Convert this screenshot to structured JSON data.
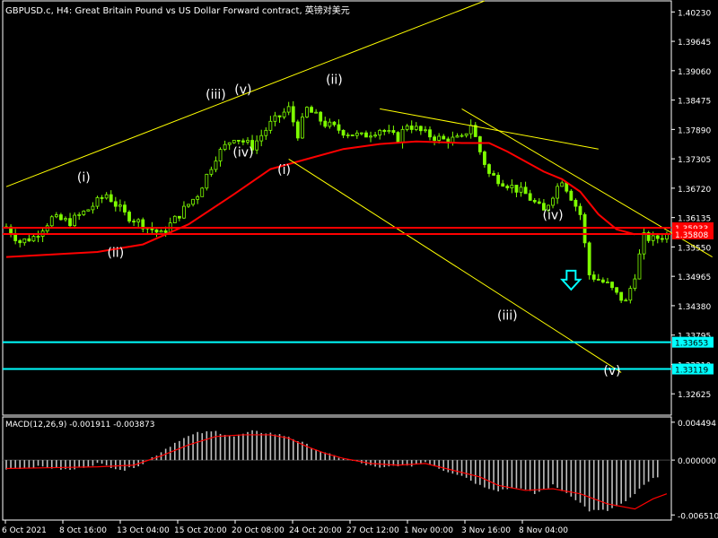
{
  "header": {
    "title": "GBPUSD.c, H4:  Great Britain Pound vs US Dollar Forward contract, 英镑对美元",
    "macd_label": "MACD(12,26,9) -0.001911 -0.003873"
  },
  "colors": {
    "background": "#000000",
    "frame": "#ffffff",
    "candle": "#7fff00",
    "ma": "#ff0000",
    "trendline": "#ffff00",
    "support": "#00ffff",
    "resistance": "#ff0000",
    "macd_hist": "#c0c0c0",
    "macd_signal": "#ff0000",
    "arrow": "#00ffff"
  },
  "chart_data": [
    {
      "type": "candlestick",
      "symbol": "GBPUSD.c",
      "timeframe": "H4",
      "y_axis_ticks": [
        "1.40230",
        "1.39645",
        "1.39060",
        "1.38475",
        "1.37890",
        "1.37305",
        "1.36720",
        "1.36135",
        "1.35550",
        "1.34965",
        "1.34380",
        "1.33795",
        "1.33210",
        "1.32625"
      ],
      "x_axis_ticks": [
        "6 Oct 2021",
        "8 Oct 16:00",
        "13 Oct 04:00",
        "15 Oct 20:00",
        "20 Oct 08:00",
        "24 Oct 20:00",
        "27 Oct 12:00",
        "1 Nov 00:00",
        "3 Nov 16:00",
        "8 Nov 04:00"
      ],
      "ylim": [
        1.322,
        1.4045
      ],
      "bars": 146,
      "close_path": [
        [
          0,
          1.3595
        ],
        [
          3,
          1.3565
        ],
        [
          6,
          1.3575
        ],
        [
          10,
          1.3612
        ],
        [
          14,
          1.3605
        ],
        [
          18,
          1.363
        ],
        [
          22,
          1.366
        ],
        [
          26,
          1.362
        ],
        [
          30,
          1.36
        ],
        [
          34,
          1.358
        ],
        [
          38,
          1.362
        ],
        [
          42,
          1.366
        ],
        [
          46,
          1.3735
        ],
        [
          50,
          1.3775
        ],
        [
          54,
          1.3755
        ],
        [
          58,
          1.38
        ],
        [
          62,
          1.383
        ],
        [
          64,
          1.378
        ],
        [
          66,
          1.383
        ],
        [
          70,
          1.38
        ],
        [
          74,
          1.3785
        ],
        [
          78,
          1.3775
        ],
        [
          82,
          1.379
        ],
        [
          86,
          1.377
        ],
        [
          88,
          1.38
        ],
        [
          92,
          1.378
        ],
        [
          96,
          1.3768
        ],
        [
          100,
          1.377
        ],
        [
          102,
          1.38
        ],
        [
          104,
          1.3745
        ],
        [
          106,
          1.37
        ],
        [
          110,
          1.368
        ],
        [
          114,
          1.366
        ],
        [
          118,
          1.3625
        ],
        [
          120,
          1.366
        ],
        [
          122,
          1.369
        ],
        [
          126,
          1.362
        ],
        [
          128,
          1.35
        ],
        [
          132,
          1.348
        ],
        [
          134,
          1.346
        ],
        [
          136,
          1.3445
        ],
        [
          138,
          1.35
        ],
        [
          140,
          1.3575
        ],
        [
          142,
          1.357
        ],
        [
          145,
          1.358
        ]
      ],
      "moving_average": [
        [
          0,
          1.3535
        ],
        [
          20,
          1.3545
        ],
        [
          30,
          1.356
        ],
        [
          40,
          1.36
        ],
        [
          50,
          1.366
        ],
        [
          58,
          1.371
        ],
        [
          66,
          1.373
        ],
        [
          74,
          1.375
        ],
        [
          82,
          1.376
        ],
        [
          90,
          1.3765
        ],
        [
          100,
          1.3762
        ],
        [
          106,
          1.3762
        ],
        [
          110,
          1.3745
        ],
        [
          118,
          1.3705
        ],
        [
          122,
          1.369
        ],
        [
          126,
          1.3665
        ],
        [
          130,
          1.362
        ],
        [
          134,
          1.359
        ],
        [
          138,
          1.358
        ]
      ],
      "horizontal_levels": [
        {
          "label": "1.35933",
          "price": 1.35933,
          "kind": "resistance"
        },
        {
          "label": "1.35808",
          "price": 1.35808,
          "kind": "resistance"
        },
        {
          "label": "1.33653",
          "price": 1.33653,
          "kind": "support"
        },
        {
          "label": "1.33119",
          "price": 1.33119,
          "kind": "support"
        }
      ],
      "trendlines": [
        {
          "from": [
            0,
            1.3675
          ],
          "to": [
            105,
            1.4045
          ]
        },
        {
          "from": [
            82,
            1.383
          ],
          "to": [
            130,
            1.375
          ]
        },
        {
          "from": [
            62,
            1.373
          ],
          "to": [
            135,
            1.3305
          ]
        },
        {
          "from": [
            100,
            1.383
          ],
          "to": [
            155,
            1.3535
          ]
        }
      ],
      "wave_labels": [
        {
          "text": "(i)",
          "x": 17,
          "price": 1.3685
        },
        {
          "text": "(ii)",
          "x": 24,
          "price": 1.3535
        },
        {
          "text": "(iii)",
          "x": 46,
          "price": 1.385
        },
        {
          "text": "(v)",
          "x": 52,
          "price": 1.386
        },
        {
          "text": "(iv)",
          "x": 52,
          "price": 1.3735
        },
        {
          "text": "(i)",
          "x": 61,
          "price": 1.37
        },
        {
          "text": "(ii)",
          "x": 72,
          "price": 1.388
        },
        {
          "text": "(iii)",
          "x": 110,
          "price": 1.341
        },
        {
          "text": "(iv)",
          "x": 120,
          "price": 1.361
        },
        {
          "text": "(v)",
          "x": 133,
          "price": 1.33
        }
      ],
      "arrow": {
        "direction": "down",
        "x": 124,
        "price": 1.3488
      }
    },
    {
      "type": "macd",
      "title": "MACD(12,26,9) -0.001911 -0.003873",
      "y_axis_ticks": [
        "0.004494",
        "0.000000",
        "-0.006510"
      ],
      "ylim": [
        -0.0068,
        0.0048
      ],
      "histogram_path": [
        [
          0,
          -0.001
        ],
        [
          8,
          -0.0008
        ],
        [
          14,
          -0.0012
        ],
        [
          20,
          -0.0004
        ],
        [
          26,
          -0.0012
        ],
        [
          30,
          -0.0004
        ],
        [
          34,
          0.001
        ],
        [
          38,
          0.0024
        ],
        [
          42,
          0.0032
        ],
        [
          46,
          0.0034
        ],
        [
          50,
          0.0028
        ],
        [
          54,
          0.0034
        ],
        [
          58,
          0.0032
        ],
        [
          62,
          0.0028
        ],
        [
          66,
          0.0018
        ],
        [
          70,
          0.0008
        ],
        [
          74,
          0.0002
        ],
        [
          78,
          -0.0004
        ],
        [
          82,
          -0.001
        ],
        [
          86,
          -0.0006
        ],
        [
          88,
          -0.0008
        ],
        [
          92,
          -0.0002
        ],
        [
          96,
          -0.0012
        ],
        [
          100,
          -0.0018
        ],
        [
          104,
          -0.003
        ],
        [
          108,
          -0.0036
        ],
        [
          112,
          -0.0032
        ],
        [
          116,
          -0.004
        ],
        [
          120,
          -0.003
        ],
        [
          124,
          -0.0042
        ],
        [
          128,
          -0.006
        ],
        [
          132,
          -0.006
        ],
        [
          136,
          -0.005
        ],
        [
          140,
          -0.003
        ],
        [
          143,
          -0.0019
        ]
      ],
      "signal_path": [
        [
          0,
          -0.001
        ],
        [
          10,
          -0.0009
        ],
        [
          20,
          -0.0008
        ],
        [
          28,
          -0.0006
        ],
        [
          34,
          0.0005
        ],
        [
          40,
          0.0018
        ],
        [
          46,
          0.0028
        ],
        [
          52,
          0.003
        ],
        [
          58,
          0.003
        ],
        [
          62,
          0.0026
        ],
        [
          66,
          0.0016
        ],
        [
          70,
          0.0008
        ],
        [
          74,
          0.0002
        ],
        [
          80,
          -0.0004
        ],
        [
          86,
          -0.0006
        ],
        [
          92,
          -0.0004
        ],
        [
          98,
          -0.0012
        ],
        [
          104,
          -0.002
        ],
        [
          108,
          -0.003
        ],
        [
          114,
          -0.0036
        ],
        [
          120,
          -0.0034
        ],
        [
          126,
          -0.004
        ],
        [
          132,
          -0.0052
        ],
        [
          138,
          -0.0058
        ],
        [
          142,
          -0.0046
        ],
        [
          145,
          -0.004
        ]
      ]
    }
  ]
}
